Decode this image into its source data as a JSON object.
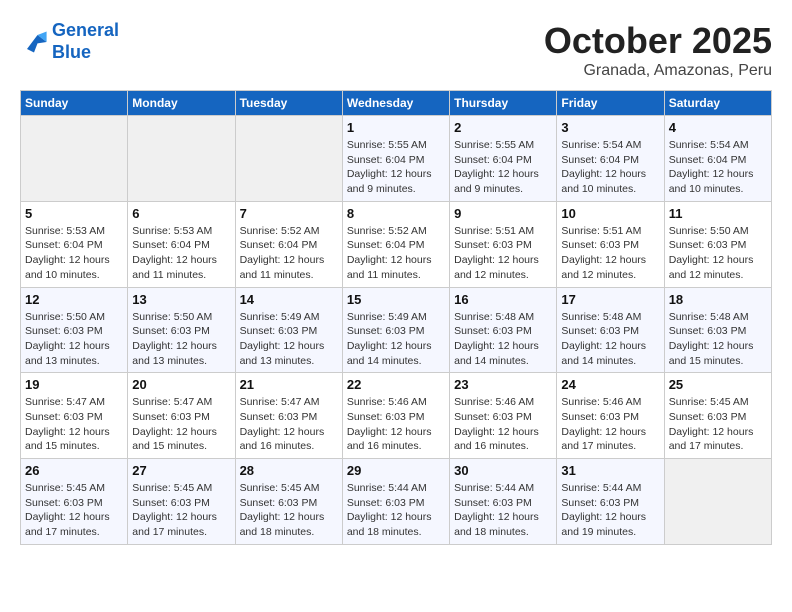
{
  "header": {
    "logo_line1": "General",
    "logo_line2": "Blue",
    "month": "October 2025",
    "location": "Granada, Amazonas, Peru"
  },
  "weekdays": [
    "Sunday",
    "Monday",
    "Tuesday",
    "Wednesday",
    "Thursday",
    "Friday",
    "Saturday"
  ],
  "weeks": [
    [
      {
        "day": "",
        "info": ""
      },
      {
        "day": "",
        "info": ""
      },
      {
        "day": "",
        "info": ""
      },
      {
        "day": "1",
        "info": "Sunrise: 5:55 AM\nSunset: 6:04 PM\nDaylight: 12 hours\nand 9 minutes."
      },
      {
        "day": "2",
        "info": "Sunrise: 5:55 AM\nSunset: 6:04 PM\nDaylight: 12 hours\nand 9 minutes."
      },
      {
        "day": "3",
        "info": "Sunrise: 5:54 AM\nSunset: 6:04 PM\nDaylight: 12 hours\nand 10 minutes."
      },
      {
        "day": "4",
        "info": "Sunrise: 5:54 AM\nSunset: 6:04 PM\nDaylight: 12 hours\nand 10 minutes."
      }
    ],
    [
      {
        "day": "5",
        "info": "Sunrise: 5:53 AM\nSunset: 6:04 PM\nDaylight: 12 hours\nand 10 minutes."
      },
      {
        "day": "6",
        "info": "Sunrise: 5:53 AM\nSunset: 6:04 PM\nDaylight: 12 hours\nand 11 minutes."
      },
      {
        "day": "7",
        "info": "Sunrise: 5:52 AM\nSunset: 6:04 PM\nDaylight: 12 hours\nand 11 minutes."
      },
      {
        "day": "8",
        "info": "Sunrise: 5:52 AM\nSunset: 6:04 PM\nDaylight: 12 hours\nand 11 minutes."
      },
      {
        "day": "9",
        "info": "Sunrise: 5:51 AM\nSunset: 6:03 PM\nDaylight: 12 hours\nand 12 minutes."
      },
      {
        "day": "10",
        "info": "Sunrise: 5:51 AM\nSunset: 6:03 PM\nDaylight: 12 hours\nand 12 minutes."
      },
      {
        "day": "11",
        "info": "Sunrise: 5:50 AM\nSunset: 6:03 PM\nDaylight: 12 hours\nand 12 minutes."
      }
    ],
    [
      {
        "day": "12",
        "info": "Sunrise: 5:50 AM\nSunset: 6:03 PM\nDaylight: 12 hours\nand 13 minutes."
      },
      {
        "day": "13",
        "info": "Sunrise: 5:50 AM\nSunset: 6:03 PM\nDaylight: 12 hours\nand 13 minutes."
      },
      {
        "day": "14",
        "info": "Sunrise: 5:49 AM\nSunset: 6:03 PM\nDaylight: 12 hours\nand 13 minutes."
      },
      {
        "day": "15",
        "info": "Sunrise: 5:49 AM\nSunset: 6:03 PM\nDaylight: 12 hours\nand 14 minutes."
      },
      {
        "day": "16",
        "info": "Sunrise: 5:48 AM\nSunset: 6:03 PM\nDaylight: 12 hours\nand 14 minutes."
      },
      {
        "day": "17",
        "info": "Sunrise: 5:48 AM\nSunset: 6:03 PM\nDaylight: 12 hours\nand 14 minutes."
      },
      {
        "day": "18",
        "info": "Sunrise: 5:48 AM\nSunset: 6:03 PM\nDaylight: 12 hours\nand 15 minutes."
      }
    ],
    [
      {
        "day": "19",
        "info": "Sunrise: 5:47 AM\nSunset: 6:03 PM\nDaylight: 12 hours\nand 15 minutes."
      },
      {
        "day": "20",
        "info": "Sunrise: 5:47 AM\nSunset: 6:03 PM\nDaylight: 12 hours\nand 15 minutes."
      },
      {
        "day": "21",
        "info": "Sunrise: 5:47 AM\nSunset: 6:03 PM\nDaylight: 12 hours\nand 16 minutes."
      },
      {
        "day": "22",
        "info": "Sunrise: 5:46 AM\nSunset: 6:03 PM\nDaylight: 12 hours\nand 16 minutes."
      },
      {
        "day": "23",
        "info": "Sunrise: 5:46 AM\nSunset: 6:03 PM\nDaylight: 12 hours\nand 16 minutes."
      },
      {
        "day": "24",
        "info": "Sunrise: 5:46 AM\nSunset: 6:03 PM\nDaylight: 12 hours\nand 17 minutes."
      },
      {
        "day": "25",
        "info": "Sunrise: 5:45 AM\nSunset: 6:03 PM\nDaylight: 12 hours\nand 17 minutes."
      }
    ],
    [
      {
        "day": "26",
        "info": "Sunrise: 5:45 AM\nSunset: 6:03 PM\nDaylight: 12 hours\nand 17 minutes."
      },
      {
        "day": "27",
        "info": "Sunrise: 5:45 AM\nSunset: 6:03 PM\nDaylight: 12 hours\nand 17 minutes."
      },
      {
        "day": "28",
        "info": "Sunrise: 5:45 AM\nSunset: 6:03 PM\nDaylight: 12 hours\nand 18 minutes."
      },
      {
        "day": "29",
        "info": "Sunrise: 5:44 AM\nSunset: 6:03 PM\nDaylight: 12 hours\nand 18 minutes."
      },
      {
        "day": "30",
        "info": "Sunrise: 5:44 AM\nSunset: 6:03 PM\nDaylight: 12 hours\nand 18 minutes."
      },
      {
        "day": "31",
        "info": "Sunrise: 5:44 AM\nSunset: 6:03 PM\nDaylight: 12 hours\nand 19 minutes."
      },
      {
        "day": "",
        "info": ""
      }
    ]
  ]
}
